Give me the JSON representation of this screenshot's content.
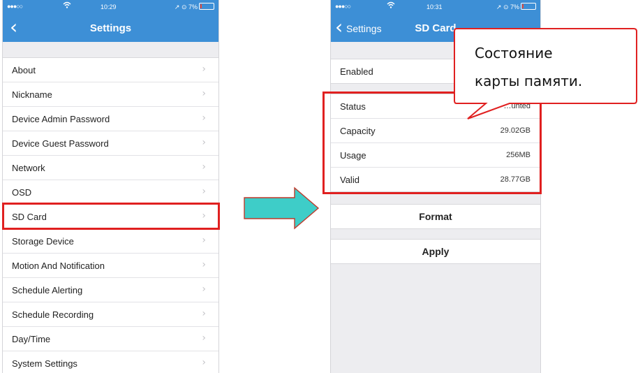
{
  "left_screen": {
    "status": {
      "signal": "●●●○○",
      "wifi": "ᯤ",
      "time": "10:29",
      "right": "↗ ⊙ 7%"
    },
    "nav": {
      "back_icon": "chevron-left",
      "title": "Settings"
    },
    "items": [
      {
        "label": "About"
      },
      {
        "label": "Nickname"
      },
      {
        "label": "Device Admin Password"
      },
      {
        "label": "Device Guest Password"
      },
      {
        "label": "Network"
      },
      {
        "label": "OSD"
      },
      {
        "label": "SD Card"
      },
      {
        "label": "Storage Device"
      },
      {
        "label": "Motion And Notification"
      },
      {
        "label": "Schedule Alerting"
      },
      {
        "label": "Schedule Recording"
      },
      {
        "label": "Day/Time"
      },
      {
        "label": "System Settings"
      }
    ]
  },
  "right_screen": {
    "status": {
      "signal": "●●●○○",
      "wifi": "ᯤ",
      "time": "10:31",
      "right": "↗ ⊙ 7%"
    },
    "nav": {
      "back_label": "Settings",
      "title": "SD Card"
    },
    "enabled_label": "Enabled",
    "details": [
      {
        "label": "Status",
        "value": "…unted"
      },
      {
        "label": "Capacity",
        "value": "29.02GB"
      },
      {
        "label": "Usage",
        "value": "256MB"
      },
      {
        "label": "Valid",
        "value": "28.77GB"
      }
    ],
    "buttons": {
      "format": "Format",
      "apply": "Apply"
    }
  },
  "annotation": {
    "callout_line1": "Состояние",
    "callout_line2": "карты памяти.",
    "arrow_color": "#3ecdc8",
    "highlight_color": "#e02020"
  }
}
